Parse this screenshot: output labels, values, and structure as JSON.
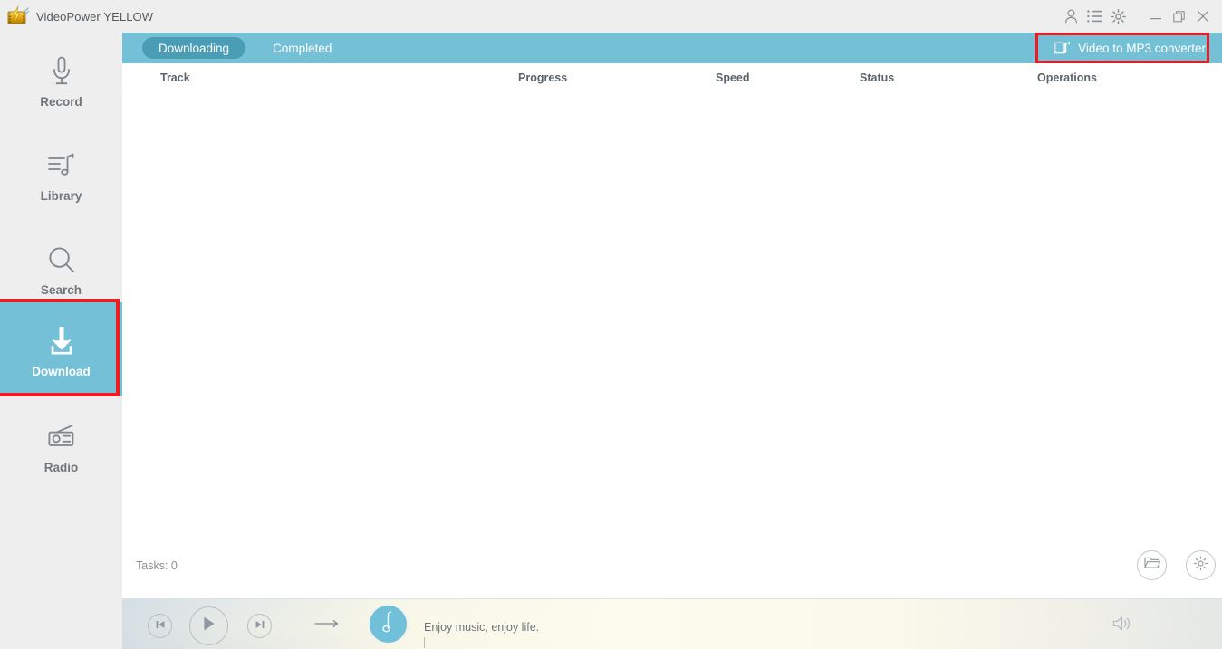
{
  "window": {
    "title": "VideoPower YELLOW",
    "logo_icon": "film-lightning-logo-icon",
    "controls": [
      {
        "name": "account-icon",
        "label": "Account"
      },
      {
        "name": "menu-list-icon",
        "label": "Menu"
      },
      {
        "name": "gear-icon",
        "label": "Settings"
      },
      {
        "name": "minimize-icon",
        "label": "Minimize"
      },
      {
        "name": "maximize-icon",
        "label": "Maximize"
      },
      {
        "name": "close-icon",
        "label": "Close"
      }
    ]
  },
  "sidebar": {
    "items": [
      {
        "label": "Record",
        "icon": "microphone-icon",
        "active": false
      },
      {
        "label": "Library",
        "icon": "music-library-icon",
        "active": false
      },
      {
        "label": "Search",
        "icon": "magnifier-icon",
        "active": false
      },
      {
        "label": "Download",
        "icon": "download-arrow-icon",
        "active": true
      },
      {
        "label": "Radio",
        "icon": "radio-icon",
        "active": false
      }
    ],
    "active_index": 3,
    "active_bg": "#74c0d6"
  },
  "highlights": {
    "color": "#ef1b20",
    "boxes": [
      "download-sidebar-item",
      "video-to-mp3-converter-button"
    ]
  },
  "tabs": {
    "items": [
      {
        "label": "Downloading",
        "active": true
      },
      {
        "label": "Completed",
        "active": false
      }
    ],
    "bar_bg": "#74c0d6",
    "active_pill_bg": "#4b9cb5"
  },
  "converter": {
    "label": "Video to MP3 converter",
    "icon": "film-music-note-icon"
  },
  "table": {
    "columns": [
      "Track",
      "Progress",
      "Speed",
      "Status",
      "Operations"
    ],
    "rows": []
  },
  "footer": {
    "tasks_label": "Tasks: 0",
    "buttons": [
      {
        "name": "open-folder-button",
        "icon": "folder-icon"
      },
      {
        "name": "download-settings-button",
        "icon": "gear-icon"
      }
    ]
  },
  "player": {
    "previous_icon": "skip-previous-icon",
    "play_icon": "play-icon",
    "next_icon": "skip-next-icon",
    "mode_icon": "repeat-arrow-icon",
    "cover_icon": "music-note-icon",
    "track_title": "Enjoy music, enjoy life.",
    "volume_icon": "speaker-icon",
    "cover_bg": "#6fc0d8"
  }
}
